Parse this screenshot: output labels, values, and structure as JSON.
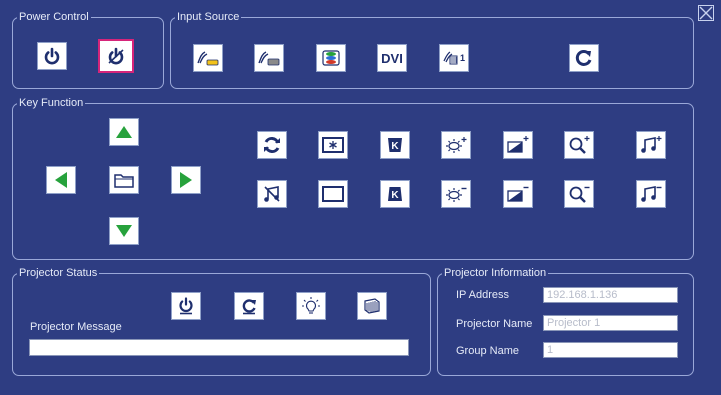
{
  "power_control": {
    "title": "Power Control"
  },
  "input_source": {
    "title": "Input Source",
    "dvi_label": "DVI",
    "input_video_badge": "1"
  },
  "key_function": {
    "title": "Key Function"
  },
  "projector_status": {
    "title": "Projector Status",
    "message_label": "Projector Message",
    "message_value": ""
  },
  "projector_information": {
    "title": "Projector Information",
    "ip_label": "IP Address",
    "ip_value": "192.168.1.136",
    "name_label": "Projector Name",
    "name_value": "Projector 1",
    "group_label": "Group Name",
    "group_value": "1"
  },
  "colors": {
    "background": "#2e3d82",
    "border": "#9aa8d8",
    "arrow_green": "#27a23c",
    "selected_outline": "#d6257a",
    "icon_navy": "#1f2f6e"
  }
}
